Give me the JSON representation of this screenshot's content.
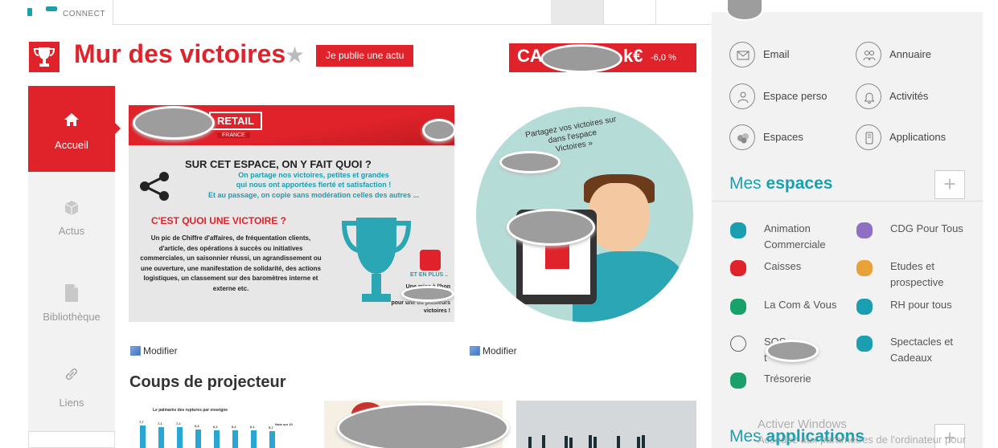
{
  "header": {
    "logo_text": "CONNECT"
  },
  "title": {
    "text": "Mur des victoires",
    "publish_label": "Je publie une actu"
  },
  "ca_badge": {
    "prefix": "CA",
    "suffix": "k€",
    "change": "-6,0 %"
  },
  "nav": {
    "items": [
      {
        "label": "Accueil",
        "icon": "home-icon",
        "active": true
      },
      {
        "label": "Actus",
        "icon": "cube-icon",
        "active": false
      },
      {
        "label": "Bibliothèque",
        "icon": "document-icon",
        "active": false
      },
      {
        "label": "Liens",
        "icon": "link-icon",
        "active": false
      }
    ]
  },
  "banner1": {
    "retail": "RETAIL",
    "france": "FRANCE",
    "question1": "SUR CET ESPACE, ON Y FAIT QUOI ?",
    "line1": "On partage nos victoires, petites et grandes",
    "line2": "qui nous ont apportées fierté et satisfaction !",
    "line3": "Et au passage, on copie sans modération celles des autres ...",
    "question2": "C'EST QUOI UNE VICTOIRE ?",
    "body": "Un pic de Chiffre d'affaires, de fréquentation clients, d'article, des opérations à succès ou initiatives commerciales, un saisonnier réussi, un agrandissement ou une ouverture, une manifestation de solidarité, des actions logistiques, un classement sur des baromètres interne et externe etc.",
    "plus": "ET EN PLUS ..",
    "une_line1": "Une mise à l'hon",
    "une_line2": "nation",
    "une_line3": "pour une ou plusieurs",
    "une_line4": "victoires !"
  },
  "banner2": {
    "line1": "Partagez vos victoires sur",
    "line2": "dans l'espace",
    "line3": "Victoires »"
  },
  "modify_label": "Modifier",
  "spotlight": {
    "title": "Coups de projecteur",
    "chart_title": "Le palmarès des ruptures par enseigne",
    "chart_note": "Note sur 10",
    "chart_values": [
      "7,7",
      "7,1",
      "7,2",
      "6,3",
      "6,2",
      "6,2",
      "6,1",
      "5,7"
    ],
    "chart_heights": [
      7.7,
      7.1,
      7.2,
      6.3,
      6.2,
      6.2,
      6.1,
      5.7
    ]
  },
  "quick_links": [
    {
      "label": "Email",
      "icon": "mail-icon"
    },
    {
      "label": "Annuaire",
      "icon": "people-icon"
    },
    {
      "label": "Espace perso",
      "icon": "person-icon"
    },
    {
      "label": "Activités",
      "icon": "bell-icon"
    },
    {
      "label": "Espaces",
      "icon": "spaces-icon"
    },
    {
      "label": "Applications",
      "icon": "apps-icon"
    }
  ],
  "my_spaces": {
    "title_light": "Mes",
    "title_bold": "espaces",
    "items": [
      {
        "label_lines": [
          "Animation",
          "Commerciale"
        ],
        "icon": "tag-icon",
        "color": "#1a9fb0"
      },
      {
        "label_lines": [
          "CDG Pour Tous",
          ""
        ],
        "icon": "puzzle-icon",
        "color": "#8e6fc1"
      },
      {
        "label_lines": [
          "Caisses",
          ""
        ],
        "icon": "register-icon",
        "color": "#e0222a"
      },
      {
        "label_lines": [
          "Etudes et",
          "prospective"
        ],
        "icon": "magnifier-icon",
        "color": "#e8a23a"
      },
      {
        "label_lines": [
          "La Com & Vous",
          ""
        ],
        "icon": "ampersand-icon",
        "color": "#1aa06a"
      },
      {
        "label_lines": [
          "RH pour tous",
          ""
        ],
        "icon": "smile-icon",
        "color": "#1a9fb0"
      },
      {
        "label_lines": [
          "SOS",
          "t"
        ],
        "icon": "question-icon",
        "color": "#666666"
      },
      {
        "label_lines": [
          "Spectacles et",
          "Cadeaux"
        ],
        "icon": "masks-icon",
        "color": "#1a9fb0"
      },
      {
        "label_lines": [
          "Trésorerie",
          ""
        ],
        "icon": "euro-icon",
        "color": "#1aa06a"
      }
    ]
  },
  "my_apps": {
    "title_light": "Mes",
    "title_bold": "applications"
  },
  "watermark": {
    "line1": "Activer Windows",
    "line2": "Accédez aux paramètres de l'ordinateur pour"
  },
  "colors": {
    "brand_red": "#e0222a",
    "teal": "#1a9fb0",
    "panel_gray": "#f2f2f2"
  }
}
